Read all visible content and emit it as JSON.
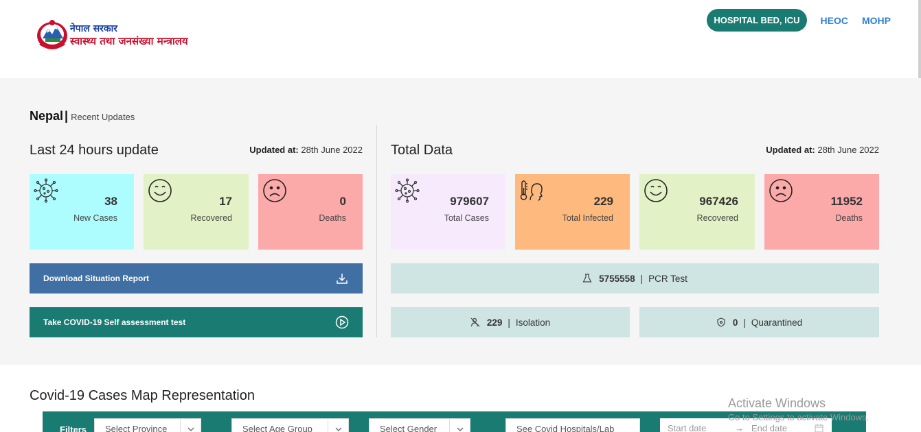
{
  "header": {
    "logo_line1": "नेपाल सरकार",
    "logo_line2": "स्वास्थ्य तथा जनसंख्या मन्त्रालय",
    "nav": {
      "hospital_bed": "HOSPITAL BED, ICU",
      "heoc": "HEOC",
      "mohp": "MOHP"
    }
  },
  "page": {
    "country": "Nepal",
    "separator": "|",
    "subtitle": "Recent Updates"
  },
  "last24": {
    "title": "Last 24 hours update",
    "updated_label": "Updated at:",
    "updated_value": "28th June 2022",
    "cards": [
      {
        "value": "38",
        "label": "New Cases",
        "color": "#adfdff"
      },
      {
        "value": "17",
        "label": "Recovered",
        "color": "#e3f2c6"
      },
      {
        "value": "0",
        "label": "Deaths",
        "color": "#fca9aa"
      }
    ],
    "download_label": "Download Situation Report",
    "selftest_label": "Take COVID-19 Self assessment test"
  },
  "total": {
    "title": "Total Data",
    "updated_label": "Updated at:",
    "updated_value": "28th June 2022",
    "cards": [
      {
        "value": "979607",
        "label": "Total Cases",
        "color": "#f6eafc"
      },
      {
        "value": "229",
        "label": "Total Infected",
        "color": "#fdb97e"
      },
      {
        "value": "967426",
        "label": "Recovered",
        "color": "#e3f2c6"
      },
      {
        "value": "11952",
        "label": "Deaths",
        "color": "#fca9aa"
      }
    ],
    "pcr_value": "5755558",
    "pcr_label": "PCR Test",
    "isolation_value": "229",
    "isolation_label": "Isolation",
    "quarantined_value": "0",
    "quarantined_label": "Quarantined",
    "sep": "|"
  },
  "map": {
    "title": "Covid-19 Cases Map Representation",
    "filters_label": "Filters",
    "province_placeholder": "Select Province",
    "age_placeholder": "Select Age Group",
    "gender_placeholder": "Select Gender",
    "hospitals_placeholder": "See Covid Hospitals/Lab",
    "start_date": "Start date",
    "arrow": "→",
    "end_date": "End date"
  },
  "watermark": {
    "line1": "Activate Windows",
    "line2": "Go to Settings to activate Windows."
  },
  "colors": {
    "teal": "#1a7b72",
    "blue_button": "#3f6fa3",
    "link": "#2d7fd0",
    "stat_bar": "#cfe5e3"
  }
}
